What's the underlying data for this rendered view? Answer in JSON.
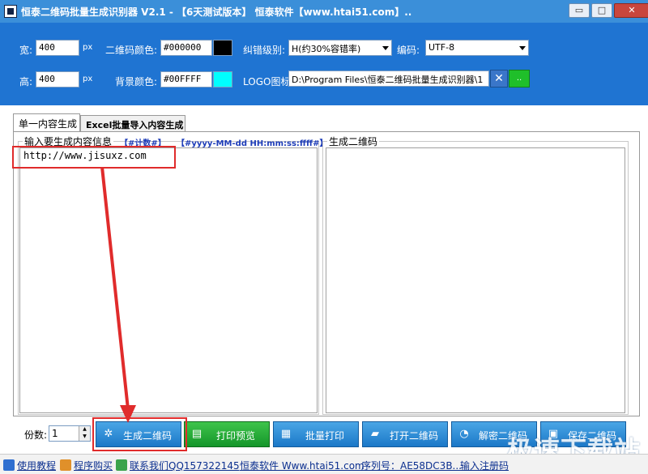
{
  "window": {
    "title": "恒泰二维码批量生成识别器 V2.1  - 【6天测试版本】 恒泰软件【www.htai51.com】..",
    "minimize": "▭",
    "maximize": "□",
    "close": "✕"
  },
  "settings": {
    "width_label": "宽:",
    "width_value": "400",
    "width_unit": "px",
    "height_label": "高:",
    "height_value": "400",
    "height_unit": "px",
    "qr_color_label": "二维码颜色:",
    "qr_color_value": "#000000",
    "qr_color_swatch": "#000000",
    "bg_color_label": "背景颜色:",
    "bg_color_value": "#00FFFF",
    "bg_color_swatch": "#00FFFF",
    "ec_level_label": "纠错级别:",
    "ec_level_value": "H(约30%容错率)",
    "encoding_label": "编码:",
    "encoding_value": "UTF-8",
    "logo_label": "LOGO图标:",
    "logo_value": "D:\\Program Files\\恒泰二维码批量生成识别器\\1",
    "logo_green_button": ".."
  },
  "tabs": [
    {
      "label": "单一内容生成"
    },
    {
      "label": "Excel批量导入内容生成"
    }
  ],
  "input_group": {
    "label": "输入要生成内容信息",
    "hint_counter": "【#计数#】",
    "hint_datetime": "【#yyyy-MM-dd HH:mm:ss:ffff#】",
    "content": "http://www.jisuxz.com"
  },
  "output_group": {
    "label": "生成二维码"
  },
  "bottom": {
    "copies_label": "份数:",
    "copies_value": "1",
    "buttons": [
      {
        "label": "生成二维码",
        "icon": "✲"
      },
      {
        "label": "打印预览",
        "icon": "▤"
      },
      {
        "label": "批量打印",
        "icon": "▦"
      },
      {
        "label": "打开二维码",
        "icon": "▰"
      },
      {
        "label": "解密二维码",
        "icon": "◔"
      },
      {
        "label": "保存二维码",
        "icon": "▣"
      }
    ]
  },
  "status_bar": [
    {
      "label": "使用教程",
      "color": "#2f6fd0"
    },
    {
      "label": "程序购买",
      "color": "#e0902a"
    },
    {
      "label": "联系我们QQ157322145",
      "color": "#3aa34a"
    },
    {
      "label": "恒泰软件 Www.htai51.com",
      "color": "#1f74d2"
    },
    {
      "label": "序列号：AE58DC3B...",
      "color": "#888888"
    },
    {
      "label": "输入注册码",
      "color": "#888888"
    }
  ],
  "watermark": "极速下载站"
}
